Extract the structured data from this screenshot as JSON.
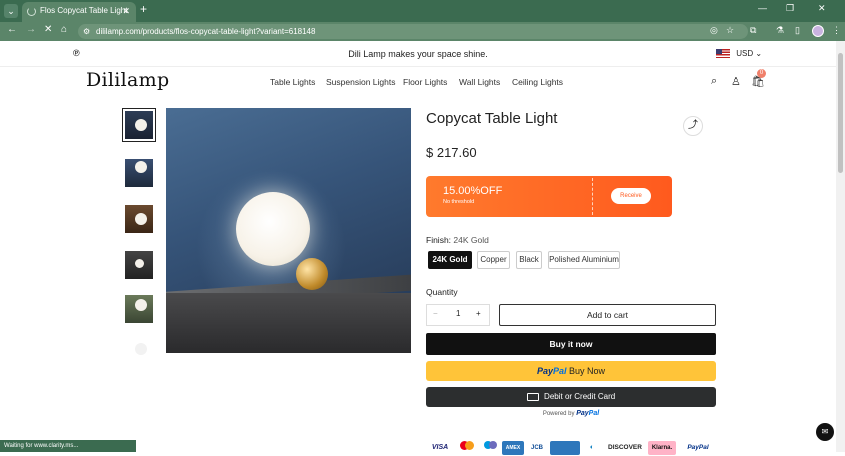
{
  "browser": {
    "tab_title": "Flos Copycat Table Light",
    "url": "dililamp.com/products/flos-copycat-table-light?variant=618148",
    "status": "Waiting for www.clarity.ms..."
  },
  "announcement": {
    "message": "Dili Lamp makes your space shine.",
    "currency": "USD"
  },
  "header": {
    "logo": "Dililamp",
    "menu": [
      "Table Lights",
      "Suspension Lights",
      "Floor Lights",
      "Wall Lights",
      "Ceiling Lights"
    ],
    "cart_count": "0"
  },
  "product": {
    "title": "Copycat Table Light",
    "price": "$ 217.60",
    "coupon": {
      "discount": "15.00%OFF",
      "note": "No threshold",
      "button": "Receive"
    },
    "finish_label": "Finish:",
    "finish_value": "24K Gold",
    "options": [
      "24K Gold",
      "Copper",
      "Black",
      "Polished Aluminium"
    ],
    "quantity_label": "Quantity",
    "quantity": "1",
    "add_to_cart": "Add to cart",
    "buy_now": "Buy it now",
    "paypal_buy_now": "Buy Now",
    "card_button": "Debit or Credit Card",
    "powered_by": "Powered by",
    "paypal_word1": "Pay",
    "paypal_word2": "Pal"
  },
  "payments": [
    "VISA",
    "",
    "",
    "AMEX",
    "JCB",
    "",
    "",
    "DISCOVER",
    "Klarna.",
    "PayPal"
  ],
  "colors": {
    "accent": "#ff5a1e",
    "paypal_yellow": "#ffc439",
    "browser_green": "#3b6b50"
  }
}
